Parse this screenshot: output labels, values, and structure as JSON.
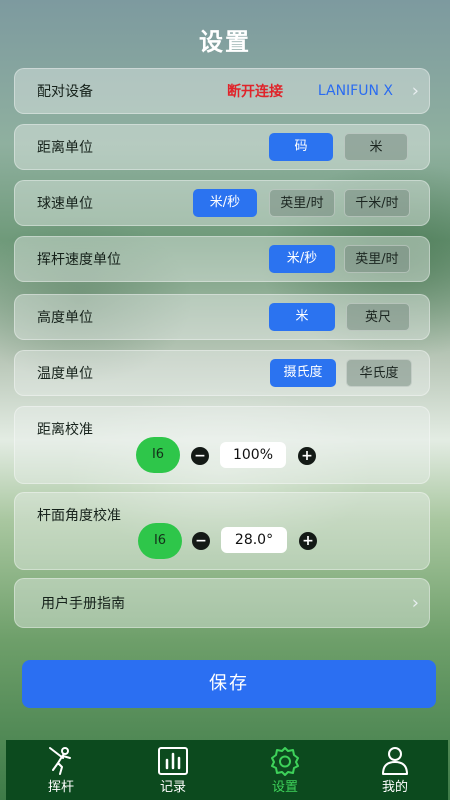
{
  "title": "设置",
  "pairing": {
    "label": "配对设备",
    "disconnect": "断开连接",
    "device": "LANIFUN X",
    "chevron": "›"
  },
  "units": [
    {
      "label": "距离单位",
      "options": [
        "码",
        "米"
      ],
      "selected": 0
    },
    {
      "label": "球速单位",
      "options": [
        "米/秒",
        "英里/时",
        "千米/时"
      ],
      "selected": 0
    },
    {
      "label": "挥杆速度单位",
      "options": [
        "米/秒",
        "英里/时"
      ],
      "selected": 0
    },
    {
      "label": "高度单位",
      "options": [
        "米",
        "英尺"
      ],
      "selected": 0
    },
    {
      "label": "温度单位",
      "options": [
        "摄氏度",
        "华氏度"
      ],
      "selected": 0
    }
  ],
  "distance_calibration": {
    "label": "距离校准",
    "club": "I6",
    "minus": "−",
    "value": "100%",
    "plus": "+"
  },
  "face_angle_calibration": {
    "label": "杆面角度校准",
    "club": "I6",
    "minus": "−",
    "value": "28.0°",
    "plus": "+"
  },
  "manual": {
    "label": "用户手册指南",
    "chevron": "›"
  },
  "save_label": "保存",
  "tabs": [
    {
      "label": "挥杆",
      "icon": "golfer-icon",
      "active": false
    },
    {
      "label": "记录",
      "icon": "chart-icon",
      "active": false
    },
    {
      "label": "设置",
      "icon": "gear-icon",
      "active": true
    },
    {
      "label": "我的",
      "icon": "user-icon",
      "active": false
    }
  ],
  "colors": {
    "accent": "#2b73f0",
    "disconnect": "#e0242a",
    "club_badge": "#2ec64a",
    "tabbar": "#0c4a1e",
    "tab_active": "#3ed25a"
  }
}
